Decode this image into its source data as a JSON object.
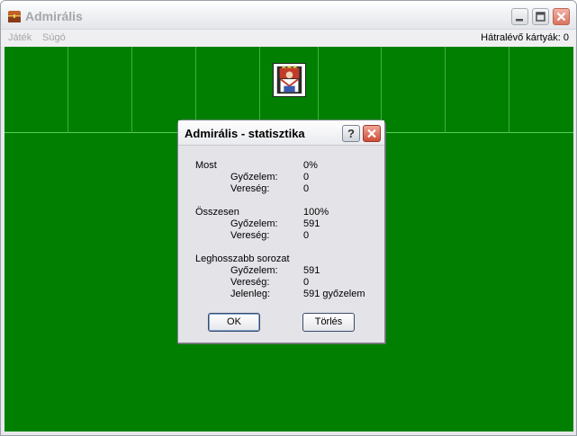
{
  "window": {
    "title": "Admirális"
  },
  "menu": {
    "items": [
      "Játék",
      "Súgó"
    ],
    "remaining_label": "Hátralévő kártyák: 0"
  },
  "dialog": {
    "title": "Admirális - statisztika",
    "help_label": "?",
    "sections": {
      "current": {
        "heading": "Most",
        "percent": "0%",
        "wins_label": "Győzelem:",
        "wins": "0",
        "losses_label": "Vereség:",
        "losses": "0"
      },
      "total": {
        "heading": "Összesen",
        "percent": "100%",
        "wins_label": "Győzelem:",
        "wins": "591",
        "losses_label": "Vereség:",
        "losses": "0"
      },
      "streak": {
        "heading": "Leghosszabb sorozat",
        "wins_label": "Győzelem:",
        "wins": "591",
        "losses_label": "Vereség:",
        "losses": "0",
        "current_label": "Jelenleg:",
        "current": "591 győzelem"
      }
    },
    "ok_label": "OK",
    "reset_label": "Törlés"
  },
  "colors": {
    "felt": "#007f00",
    "felt_lines": "#3fb23f"
  },
  "icons": {
    "app": "treasure-chest-icon",
    "card": "king-card-icon"
  }
}
